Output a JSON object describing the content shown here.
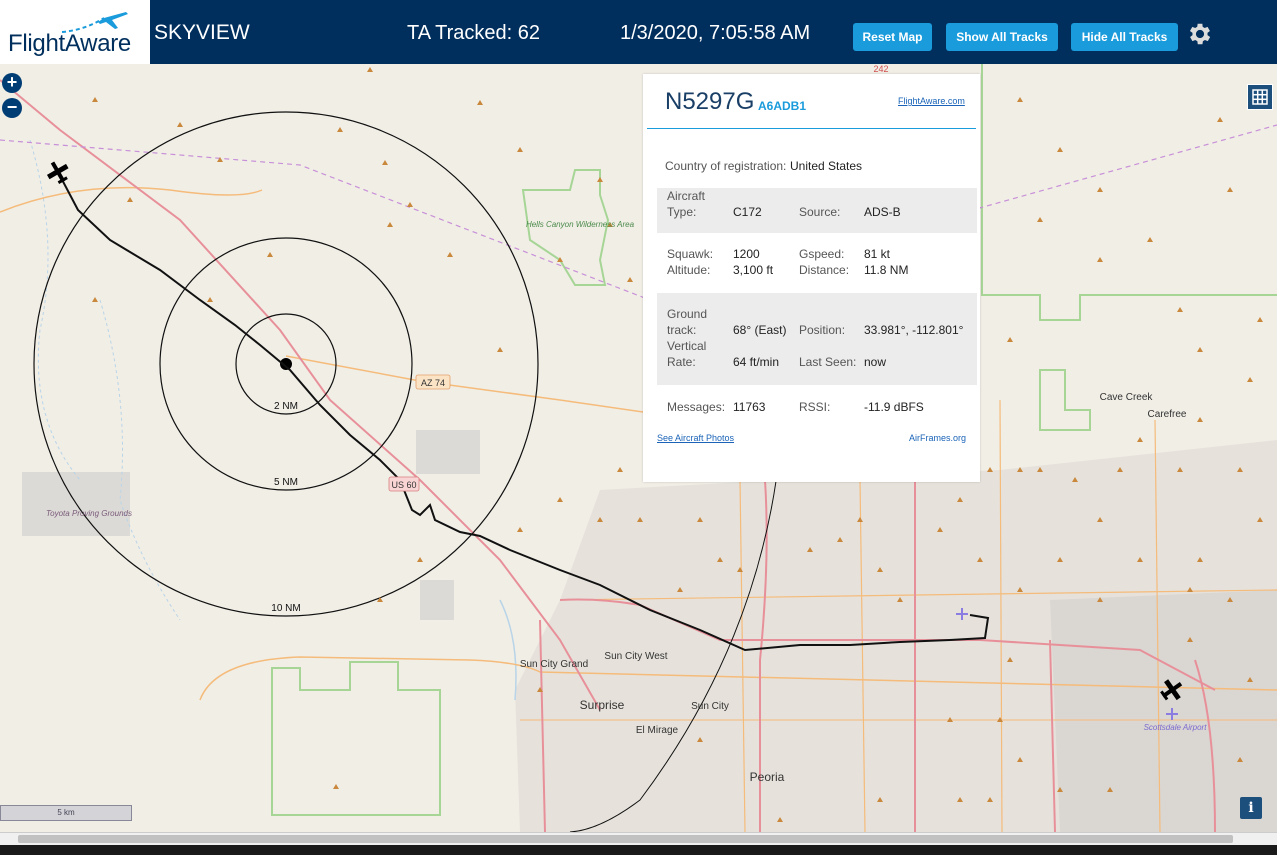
{
  "header": {
    "logo_text": "FlightAware",
    "app_title": "SKYVIEW",
    "tracked": "TA Tracked: 62",
    "datetime": "1/3/2020, 7:05:58 AM",
    "buttons": {
      "reset": "Reset Map",
      "show_all": "Show All Tracks",
      "hide_all": "Hide All Tracks"
    }
  },
  "map_controls": {
    "zoom_in": "+",
    "zoom_out": "−",
    "info": "i",
    "scale": "5 km"
  },
  "range_rings": [
    "2 NM",
    "5 NM",
    "10 NM"
  ],
  "map_labels": {
    "az74": "AZ 74",
    "us60": "US 60",
    "hells_canyon": "Hells Canyon Wilderness Area",
    "tovota": "Toyota Proving Grounds",
    "sun_city_grand": "Sun City Grand",
    "sun_city_west": "Sun City West",
    "surprise": "Surprise",
    "sun_city": "Sun City",
    "el_mirage": "El Mirage",
    "peoria": "Peoria",
    "cave_creek": "Cave Creek",
    "carefree": "Carefree",
    "scottsdale_airport": "Scottsdale Airport",
    "hwy_242": "242"
  },
  "aircraft_panel": {
    "registration": "N5297G",
    "hex": "A6ADB1",
    "flightaware_link": "FlightAware.com",
    "country_label": "Country of registration:",
    "country_value": "United States",
    "rows": {
      "aircraft_type_label": "Aircraft Type:",
      "aircraft_type_value": "C172",
      "source_label": "Source:",
      "source_value": "ADS-B",
      "squawk_label": "Squawk:",
      "squawk_value": "1200",
      "gspeed_label": "Gspeed:",
      "gspeed_value": "81 kt",
      "altitude_label": "Altitude:",
      "altitude_value": "3,100 ft",
      "distance_label": "Distance:",
      "distance_value": "11.8 NM",
      "ground_track_label": "Ground track:",
      "ground_track_value": "68° (East)",
      "position_label": "Position:",
      "position_value": "33.981°, -112.801°",
      "vertical_rate_label": "Vertical Rate:",
      "vertical_rate_value": "64 ft/min",
      "last_seen_label": "Last Seen:",
      "last_seen_value": "now",
      "messages_label": "Messages:",
      "messages_value": "11763",
      "rssi_label": "RSSI:",
      "rssi_value": "-11.9 dBFS"
    },
    "photos_link": "See Aircraft Photos",
    "airframes_link": "AirFrames.org"
  },
  "colors": {
    "header_bg": "#002f5d",
    "button_bg": "#1a9bdb",
    "track": "#111111",
    "road_primary": "#e8909a",
    "road_secondary": "#f5bb7a"
  }
}
